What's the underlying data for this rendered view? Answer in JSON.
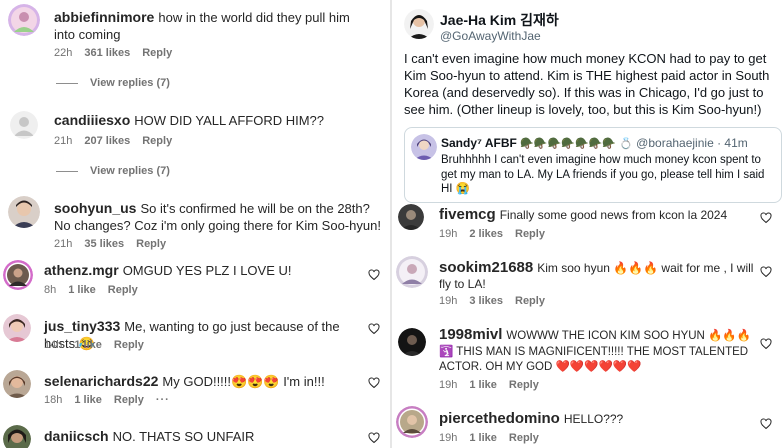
{
  "left_comments": [
    {
      "username": "abbiefinnimore",
      "text": "how in the world did they pull him into coming",
      "time": "22h",
      "likes": "361 likes",
      "reply": "Reply",
      "view_replies": "View replies (7)"
    },
    {
      "username": "candiiiesxo",
      "text": "HOW DID YALL AFFORD HIM??",
      "time": "21h",
      "likes": "207 likes",
      "reply": "Reply",
      "view_replies": "View replies (7)"
    },
    {
      "username": "soohyun_us",
      "text": "So it's confirmed he will be on the 28th? No changes? Coz i'm only going there for Kim Soo-hyun!",
      "time": "21h",
      "likes": "35 likes",
      "reply": "Reply"
    },
    {
      "username": "athenz.mgr",
      "text": "OMGUD YES PLZ I LOVE U!",
      "time": "8h",
      "likes": "1 like",
      "reply": "Reply"
    },
    {
      "username": "jus_tiny333",
      "text": "Me, wanting to go just because of the hosts 😂",
      "time": "14h",
      "likes": "1 like",
      "reply": "Reply"
    },
    {
      "username": "selenarichards22",
      "text": "My GOD!!!!!😍😍😍 I'm in!!!",
      "time": "18h",
      "likes": "1 like",
      "reply": "Reply",
      "more": "···"
    },
    {
      "username": "daniicsch",
      "text": "NO. THATS SO UNFAIR"
    }
  ],
  "tweet": {
    "name": "Jae-Ha Kim 김재하",
    "handle": "@GoAwayWithJae",
    "body": "I can't even imagine how much money KCON had to pay to get Kim Soo-hyun to attend. Kim is THE highest paid actor in South Korea (and deservedly so). If this was in Chicago, I'd go just to see him. (Other lineup is lovely, too, but this is Kim Soo-hyun!)",
    "quote": {
      "name": "Sandy⁷ AFBF",
      "badges": "🪖🪖🪖🪖🪖🪖🪖 💍",
      "handle": "@borahaejinie",
      "time": "· 41m",
      "body": "Bruhhhhh I can't even imagine how much money kcon spent to get my man to LA. My LA friends if you go, please tell him I said HI 😭"
    }
  },
  "right_comments": [
    {
      "username": "fivemcg",
      "text": "Finally some good news from kcon la 2024",
      "time": "19h",
      "likes": "2 likes",
      "reply": "Reply"
    },
    {
      "username": "sookim21688",
      "text": "Kim soo hyun 🔥🔥🔥 wait for me , I will fly to LA!",
      "time": "19h",
      "likes": "3 likes",
      "reply": "Reply"
    },
    {
      "username": "1998mivl",
      "text": "WOWWW THE ICON KIM SOO HYUN 🔥🔥🔥🛐 THIS MAN IS MAGNIFICENT!!!!! THE MOST TALENTED ACTOR. OH MY GOD ❤️❤️❤️❤️❤️❤️",
      "time": "19h",
      "likes": "1 like",
      "reply": "Reply"
    },
    {
      "username": "piercethedomino",
      "text": "HELLO???",
      "time": "19h",
      "likes": "1 like",
      "reply": "Reply"
    }
  ],
  "colors": {
    "text": "#262626",
    "meta": "#737373",
    "twitter_text": "#0f1419",
    "twitter_gray": "#536471"
  }
}
